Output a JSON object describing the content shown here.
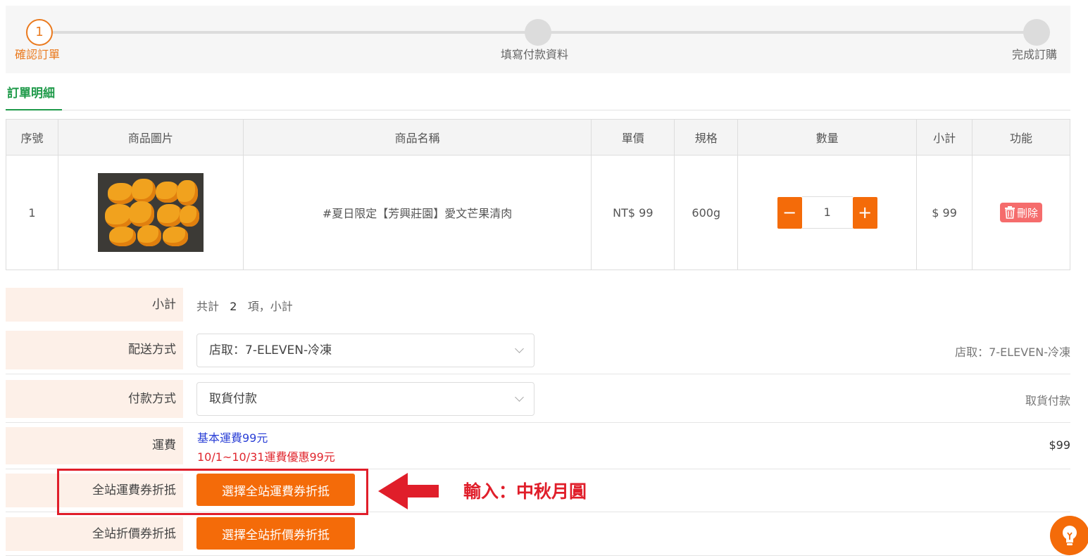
{
  "steps": [
    {
      "number": "1",
      "label": "確認訂單",
      "active": true
    },
    {
      "number": "",
      "label": "填寫付款資料",
      "active": false
    },
    {
      "number": "",
      "label": "完成訂購",
      "active": false
    }
  ],
  "section_tab": "訂單明細",
  "table": {
    "headers": [
      "序號",
      "商品圖片",
      "商品名稱",
      "單價",
      "規格",
      "數量",
      "小計",
      "功能"
    ],
    "rows": [
      {
        "index": "1",
        "name": "#夏日限定【芳興莊園】愛文芒果清肉",
        "price": "NT$ 99",
        "spec": "600g",
        "qty": "1",
        "minus": "−",
        "plus": "+",
        "subtotal": "$ 99",
        "delete": "刪除"
      }
    ]
  },
  "summary": {
    "subtotal_label": "小計",
    "subtotal_prefix": "共計",
    "subtotal_count": "2",
    "subtotal_suffix": "項，小計",
    "shipping_method_label": "配送方式",
    "shipping_method_value": "店取：7-ELEVEN-冷凍",
    "shipping_method_display": "店取：7-ELEVEN-冷凍",
    "payment_method_label": "付款方式",
    "payment_method_value": "取貨付款",
    "payment_method_display": "取貨付款",
    "freight_label": "運費",
    "freight_note_1": "基本運費99元",
    "freight_note_2": "10/1~10/31運費優惠99元",
    "freight_amount": "$99",
    "freight_coupon_label": "全站運費券折抵",
    "freight_coupon_button": "選擇全站運費券折抵",
    "discount_coupon_label": "全站折價券折抵",
    "discount_coupon_button": "選擇全站折價券折抵"
  },
  "annotation": {
    "text": "輸入：中秋月圓",
    "color": "#e01e2a"
  },
  "colors": {
    "accent": "#f46b09",
    "green": "#1f9a4a",
    "label_bg": "#fdf0e8",
    "delete": "#f56c6c",
    "link_blue": "#2a3fd6",
    "promo_red": "#e0262e"
  },
  "icons": [
    "trash-icon",
    "chevron-down-icon",
    "lightbulb-icon",
    "arrow-left-icon"
  ]
}
